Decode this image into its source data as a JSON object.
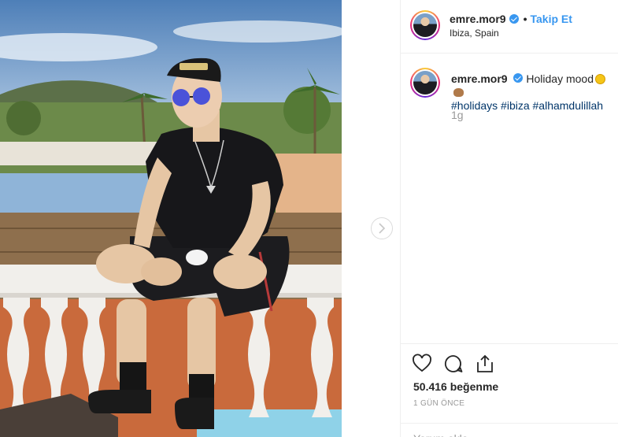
{
  "post": {
    "username": "emre.mor9",
    "separator": "•",
    "follow_label": "Takip Et",
    "location": "Ibiza, Spain"
  },
  "caption": {
    "username": "emre.mor9",
    "text": "Holiday mood",
    "hashtags": "#holidays #ibiza #alhamdulillah",
    "age": "1g"
  },
  "stats": {
    "likes": "50.416 beğenme",
    "time_ago": "1 GÜN ÖNCE"
  },
  "comment": {
    "placeholder": "Yorum ekle..."
  },
  "icons": {
    "like": "heart-icon",
    "comment": "comment-icon",
    "share": "share-icon",
    "next": "chevron-right-icon",
    "verified": "verified-badge-icon"
  },
  "colors": {
    "accent": "#3897f0",
    "hashtag": "#003569",
    "muted": "#999999"
  }
}
